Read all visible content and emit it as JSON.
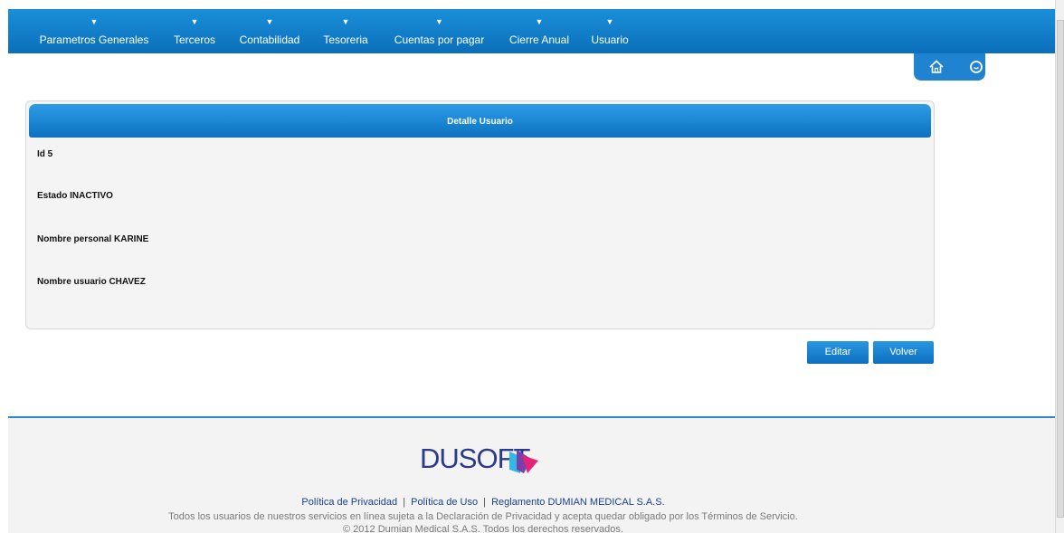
{
  "nav": {
    "items": [
      {
        "label": "Parametros Generales"
      },
      {
        "label": "Terceros"
      },
      {
        "label": "Contabilidad"
      },
      {
        "label": "Tesoreria"
      },
      {
        "label": "Cuentas por pagar"
      },
      {
        "label": "Cierre Anual"
      },
      {
        "label": "Usuario"
      }
    ],
    "arrow": "▼"
  },
  "icons": {
    "home": "home-icon",
    "power": "power-icon"
  },
  "panel": {
    "title": "Detalle Usuario",
    "fields": [
      {
        "text": "Id 5"
      },
      {
        "text": "Estado INACTIVO"
      },
      {
        "text": "Nombre personal KARINE"
      },
      {
        "text": "Nombre usuario CHAVEZ"
      }
    ]
  },
  "actions": {
    "edit_label": "Editar",
    "back_label": "Volver"
  },
  "footer": {
    "logo_text": "DUSOFT",
    "links": [
      "Política de Privacidad",
      "Política de Uso",
      "Reglamento DUMIAN MEDICAL S.A.S."
    ],
    "link_separator": "|",
    "terms": "Todos los usuarios de nuestros servicios en línea sujeta a la Declaración de Privacidad y acepta quedar obligado por los Términos de Servicio.",
    "copyright": "© 2012 Dumian Medical S.A.S. Todos los derechos reservados."
  },
  "colors": {
    "brand_blue": "#0b6fba",
    "logo_blue": "#2b3b8c",
    "logo_accent": "#e0257a"
  }
}
